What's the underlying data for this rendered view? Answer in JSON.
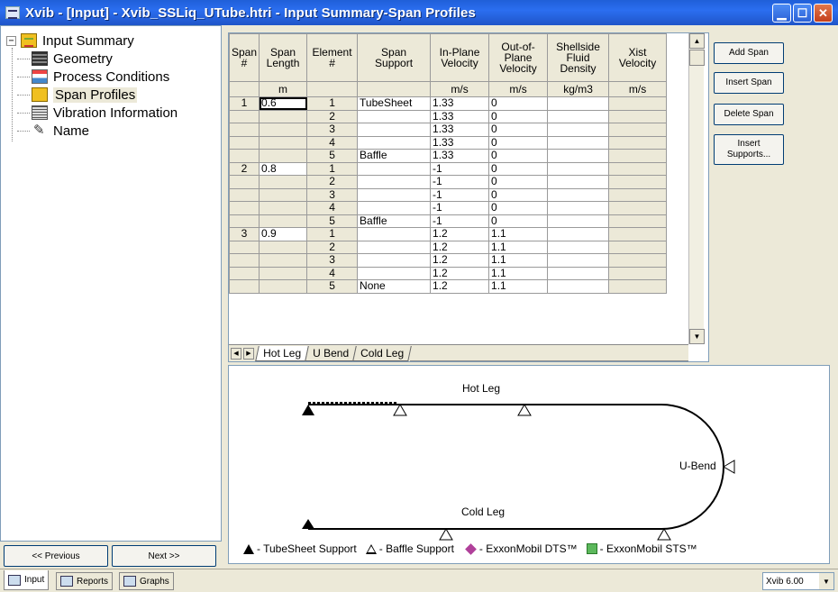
{
  "window": {
    "title": "Xvib - [Input] - Xvib_SSLiq_UTube.htri - Input Summary-Span Profiles",
    "controls": {
      "minimize": "▁",
      "maximize": "☐",
      "close": "✕"
    }
  },
  "tree": {
    "root": "Input Summary",
    "items": [
      {
        "label": "Geometry",
        "icon": "geometry-icon"
      },
      {
        "label": "Process Conditions",
        "icon": "process-conditions-icon"
      },
      {
        "label": "Span Profiles",
        "icon": "span-profiles-icon",
        "selected": true
      },
      {
        "label": "Vibration Information",
        "icon": "vibration-icon"
      },
      {
        "label": "Name",
        "icon": "name-icon"
      }
    ]
  },
  "nav": {
    "previous": "<< Previous",
    "next": "Next >>"
  },
  "grid": {
    "headers": [
      "Span #",
      "Span Length",
      "Element #",
      "Span Support",
      "In-Plane Velocity",
      "Out-of-Plane Velocity",
      "Shellside Fluid Density",
      "Xist Velocity"
    ],
    "header_lines": [
      [
        "Span",
        "#"
      ],
      [
        "Span",
        "Length"
      ],
      [
        "Element",
        "#"
      ],
      [
        "Span",
        "Support"
      ],
      [
        "In-Plane",
        "Velocity"
      ],
      [
        "Out-of-",
        "Plane",
        "Velocity"
      ],
      [
        "Shellside",
        "Fluid",
        "Density"
      ],
      [
        "Xist",
        "Velocity"
      ]
    ],
    "units": [
      "",
      "m",
      "",
      "",
      "m/s",
      "m/s",
      "kg/m3",
      "m/s"
    ],
    "rows": [
      [
        "1",
        "0.6",
        "1",
        "TubeSheet",
        "1.33",
        "0",
        "",
        ""
      ],
      [
        "",
        "",
        "2",
        "",
        "1.33",
        "0",
        "",
        ""
      ],
      [
        "",
        "",
        "3",
        "",
        "1.33",
        "0",
        "",
        ""
      ],
      [
        "",
        "",
        "4",
        "",
        "1.33",
        "0",
        "",
        ""
      ],
      [
        "",
        "",
        "5",
        "Baffle",
        "1.33",
        "0",
        "",
        ""
      ],
      [
        "2",
        "0.8",
        "1",
        "",
        "-1",
        "0",
        "",
        ""
      ],
      [
        "",
        "",
        "2",
        "",
        "-1",
        "0",
        "",
        ""
      ],
      [
        "",
        "",
        "3",
        "",
        "-1",
        "0",
        "",
        ""
      ],
      [
        "",
        "",
        "4",
        "",
        "-1",
        "0",
        "",
        ""
      ],
      [
        "",
        "",
        "5",
        "Baffle",
        "-1",
        "0",
        "",
        ""
      ],
      [
        "3",
        "0.9",
        "1",
        "",
        "1.2",
        "1.1",
        "",
        ""
      ],
      [
        "",
        "",
        "2",
        "",
        "1.2",
        "1.1",
        "",
        ""
      ],
      [
        "",
        "",
        "3",
        "",
        "1.2",
        "1.1",
        "",
        ""
      ],
      [
        "",
        "",
        "4",
        "",
        "1.2",
        "1.1",
        "",
        ""
      ],
      [
        "",
        "",
        "5",
        "None",
        "1.2",
        "1.1",
        "",
        ""
      ]
    ],
    "sheet_tabs": [
      "Hot Leg",
      "U Bend",
      "Cold Leg"
    ],
    "active_sheet": "Hot Leg"
  },
  "actions": {
    "add_span": "Add Span",
    "insert_span": "Insert Span",
    "delete_span": "Delete Span",
    "insert_supports": "Insert Supports..."
  },
  "diagram": {
    "hot_leg": "Hot Leg",
    "u_bend": "U-Bend",
    "cold_leg": "Cold Leg",
    "legend": {
      "tubesheet": "- TubeSheet Support",
      "baffle": "- Baffle Support",
      "dts": "- ExxonMobil DTS™",
      "sts": "- ExxonMobil STS™"
    },
    "colors": {
      "dts": "#b0409a",
      "sts": "#5cb85c"
    }
  },
  "statusbar": {
    "tabs": [
      "Input",
      "Reports",
      "Graphs"
    ],
    "active_tab": "Input",
    "version": "Xvib 6.00"
  }
}
